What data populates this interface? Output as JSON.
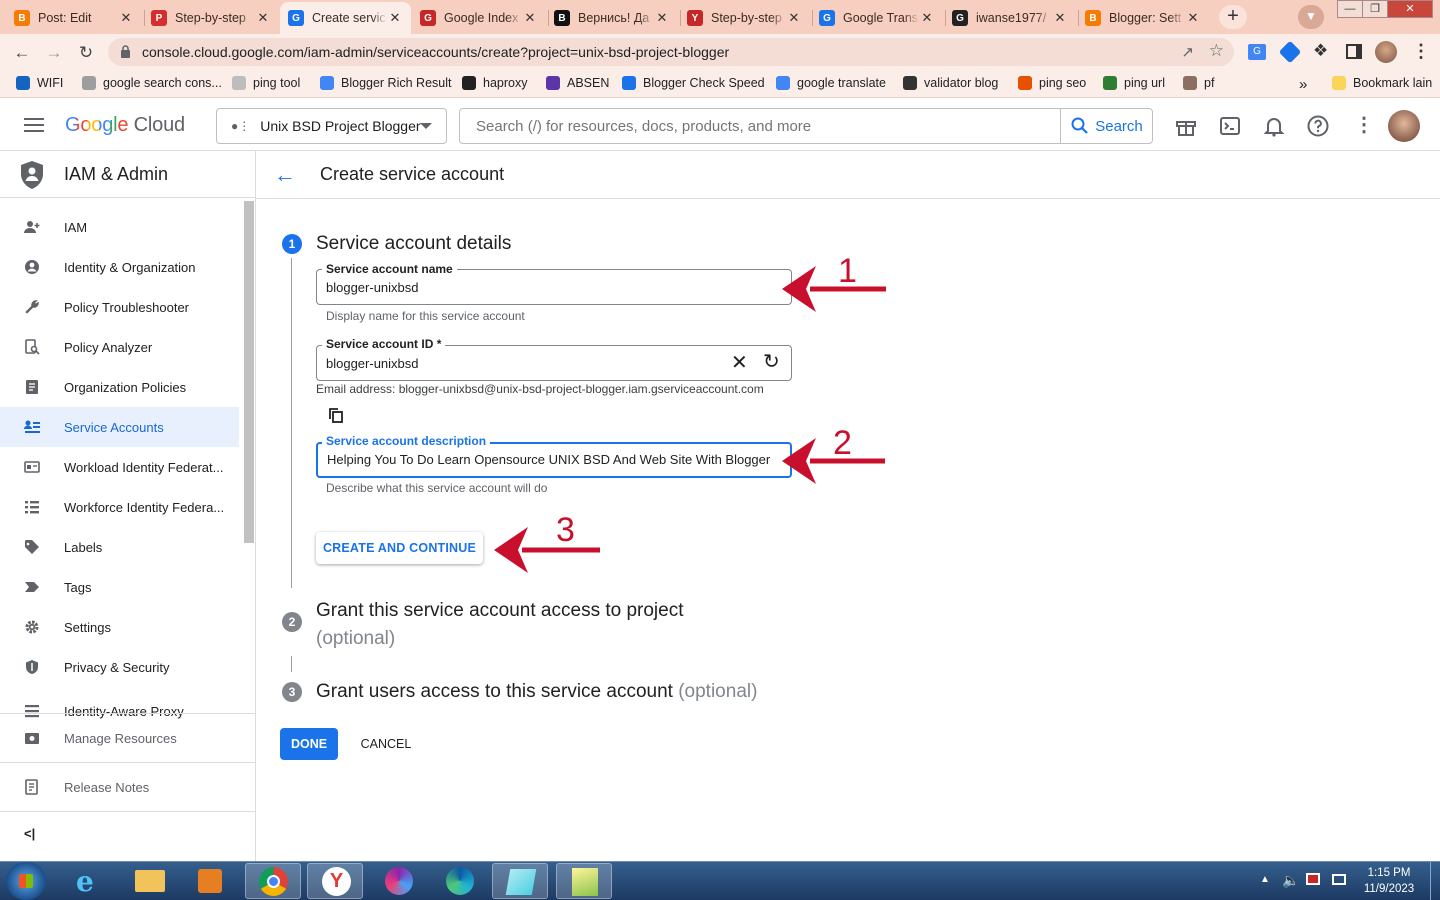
{
  "browser": {
    "tabs": [
      {
        "title": "Post: Edit",
        "fav_color": "#f57c00",
        "fav_glyph": "B"
      },
      {
        "title": "Step-by-step",
        "fav_color": "#d32f2f",
        "fav_glyph": "P"
      },
      {
        "title": "Create service",
        "fav_color": "#1a73e8",
        "fav_glyph": "G"
      },
      {
        "title": "Google Index",
        "fav_color": "#c62828",
        "fav_glyph": "G"
      },
      {
        "title": "Вернись! Да",
        "fav_color": "#111111",
        "fav_glyph": "B"
      },
      {
        "title": "Step-by-step",
        "fav_color": "#c62828",
        "fav_glyph": "Y"
      },
      {
        "title": "Google Trans",
        "fav_color": "#1a73e8",
        "fav_glyph": "G"
      },
      {
        "title": "iwanse1977/",
        "fav_color": "#222222",
        "fav_glyph": "G"
      },
      {
        "title": "Blogger: Sett",
        "fav_color": "#f57c00",
        "fav_glyph": "B"
      }
    ],
    "url": "console.cloud.google.com/iam-admin/serviceaccounts/create?project=unix-bsd-project-blogger",
    "bookmarks": [
      {
        "label": "WIFI",
        "color": "#1565c0"
      },
      {
        "label": "google search cons...",
        "color": "#9e9e9e"
      },
      {
        "label": "ping tool",
        "color": "#bdbdbd"
      },
      {
        "label": "Blogger Rich Result",
        "color": "#4285f4"
      },
      {
        "label": "haproxy",
        "color": "#222222"
      },
      {
        "label": "ABSEN",
        "color": "#5c35a8"
      },
      {
        "label": "Blogger Check Speed",
        "color": "#1a73e8"
      },
      {
        "label": "google translate",
        "color": "#4285f4"
      },
      {
        "label": "validator blog",
        "color": "#333333"
      },
      {
        "label": "ping seo",
        "color": "#e65100"
      },
      {
        "label": "ping url",
        "color": "#2e7d32"
      },
      {
        "label": "pf",
        "color": "#8d6e63"
      }
    ],
    "bookmarks_overflow": "»",
    "bookmark_folder": "Bookmark lain"
  },
  "console": {
    "logo_word1": "Google",
    "logo_word2": "Cloud",
    "project": "Unix BSD Project Blogger",
    "search_placeholder": "Search (/) for resources, docs, products, and more",
    "search_button": "Search"
  },
  "sidebar": {
    "title": "IAM & Admin",
    "items": [
      {
        "label": "IAM",
        "icon": "person-add-icon"
      },
      {
        "label": "Identity & Organization",
        "icon": "account-circle-icon"
      },
      {
        "label": "Policy Troubleshooter",
        "icon": "wrench-icon"
      },
      {
        "label": "Policy Analyzer",
        "icon": "document-search-icon"
      },
      {
        "label": "Organization Policies",
        "icon": "list-doc-icon"
      },
      {
        "label": "Service Accounts",
        "icon": "service-account-icon"
      },
      {
        "label": "Workload Identity Federat...",
        "icon": "id-card-icon"
      },
      {
        "label": "Workforce Identity Federa...",
        "icon": "list-icon"
      },
      {
        "label": "Labels",
        "icon": "tag-icon"
      },
      {
        "label": "Tags",
        "icon": "chevron-tag-icon"
      },
      {
        "label": "Settings",
        "icon": "gear-icon"
      },
      {
        "label": "Privacy & Security",
        "icon": "shield-icon"
      },
      {
        "label": "Identity-Aware Proxy",
        "icon": "proxy-icon"
      }
    ],
    "selected_index": 5,
    "manage_resources": "Manage Resources",
    "release_notes": "Release Notes",
    "collapse": "<|"
  },
  "page": {
    "title": "Create service account",
    "step1": {
      "number": "1",
      "title": "Service account details",
      "name_label": "Service account name",
      "name_value": "blogger-unixbsd",
      "name_hint": "Display name for this service account",
      "id_label": "Service account ID *",
      "id_value": "blogger-unixbsd",
      "email_text": "Email address: blogger-unixbsd@unix-bsd-project-blogger.iam.gserviceaccount.com",
      "desc_label": "Service account description",
      "desc_value": "Helping You To Do Learn Opensource UNIX BSD And Web Site With Blogger",
      "desc_hint": "Describe what this service account will do",
      "create_button": "CREATE AND CONTINUE"
    },
    "step2": {
      "number": "2",
      "title": "Grant this service account access to project",
      "optional": "(optional)"
    },
    "step3": {
      "number": "3",
      "title": "Grant users access to this service account",
      "optional": "(optional)"
    },
    "done_button": "DONE",
    "cancel_button": "CANCEL"
  },
  "annotations": [
    "1",
    "2",
    "3"
  ],
  "annotation_color": "#c8102e",
  "accent_color": "#1a73e8",
  "taskbar": {
    "time": "1:15 PM",
    "date": "11/9/2023"
  }
}
